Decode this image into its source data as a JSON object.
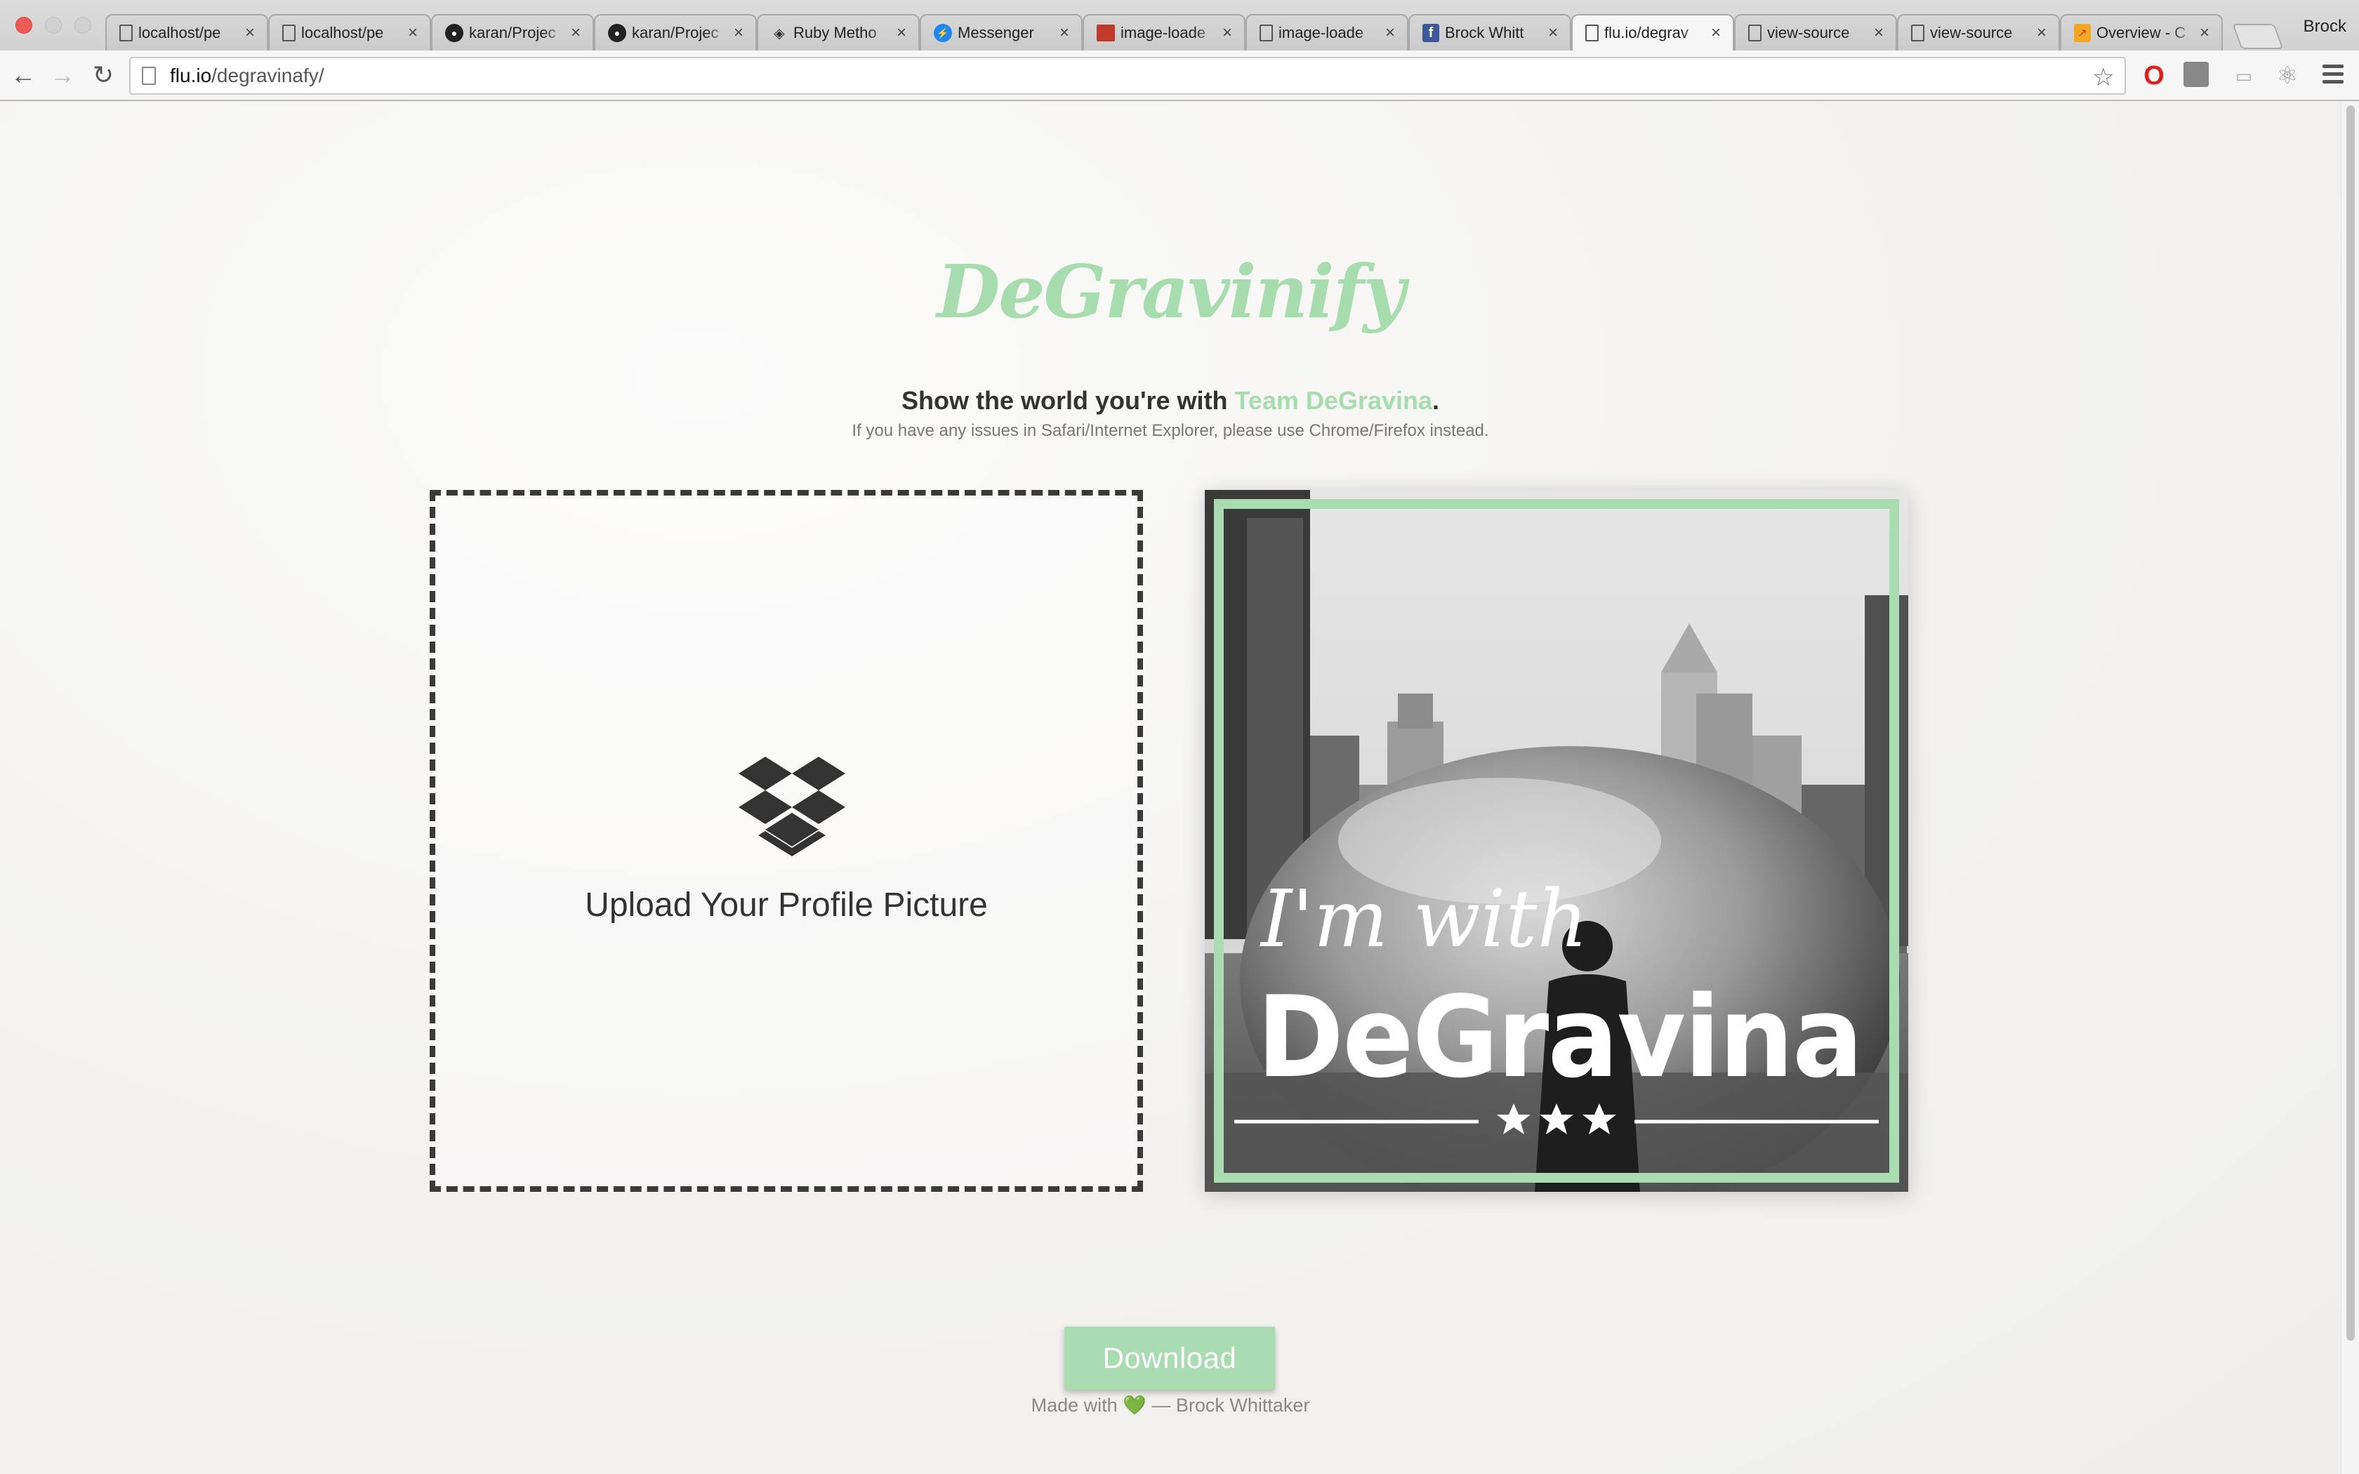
{
  "browser": {
    "tabs": [
      {
        "label": "localhost/pe",
        "icon": "document-icon"
      },
      {
        "label": "localhost/pe",
        "icon": "document-icon"
      },
      {
        "label": "karan/Projec",
        "icon": "github-icon"
      },
      {
        "label": "karan/Projec",
        "icon": "github-icon"
      },
      {
        "label": "Ruby Metho",
        "icon": "ruby-icon"
      },
      {
        "label": "Messenger",
        "icon": "messenger-icon"
      },
      {
        "label": "image-loade",
        "icon": "image-icon"
      },
      {
        "label": "image-loade",
        "icon": "document-icon"
      },
      {
        "label": "Brock Whitt",
        "icon": "facebook-icon"
      },
      {
        "label": "flu.io/degrav",
        "icon": "document-icon",
        "active": true
      },
      {
        "label": "view-source",
        "icon": "document-icon"
      },
      {
        "label": "view-source",
        "icon": "document-icon"
      },
      {
        "label": "Overview - C",
        "icon": "analytics-icon"
      }
    ],
    "profile_name": "Brock",
    "url_host": "flu.io",
    "url_path": "/degravinafy/"
  },
  "page": {
    "logo": "DeGravinify",
    "headline_prefix": "Show the world you're with ",
    "headline_accent": "Team DeGravina",
    "headline_suffix": ".",
    "note": "If you have any issues in Safari/Internet Explorer, please use Chrome/Firefox instead.",
    "upload_label": "Upload Your Profile Picture",
    "overlay_line1": "I'm with",
    "overlay_line2": "DeGravina",
    "download_label": "Download",
    "credits_prefix": "Made with ",
    "credits_heart": "💚",
    "credits_suffix": " — Brock Whittaker"
  },
  "colors": {
    "accent_green": "#a6dcae",
    "frame_green": "#a9dcb1",
    "text_dark": "#333333"
  }
}
